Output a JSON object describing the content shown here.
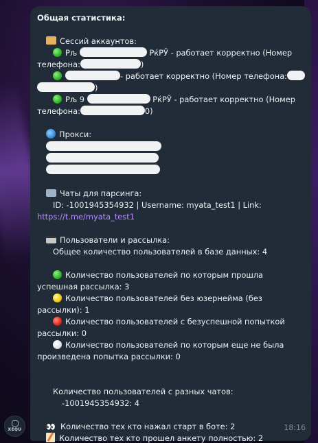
{
  "message": {
    "title": "Общая статистика:",
    "sessions": {
      "header": "Сессий аккаунтов:",
      "items": [
        {
          "prefix": "Рљ",
          "suffix": "РќРЎ - работает корректно (Номер",
          "line2_prefix": "телефона:",
          "line2_suffix": ")"
        },
        {
          "prefix": "",
          "suffix": "- работает корректно (Номер телефона:",
          "line2_prefix": "",
          "line2_suffix": ")"
        },
        {
          "prefix": "Рљ 9",
          "suffix": "РќРЎ - работает корректно (Номер",
          "line2_prefix": "телефона:",
          "line2_suffix": "0)"
        }
      ]
    },
    "proxy": {
      "header": "Прокси:"
    },
    "chats": {
      "header": "Чаты для парсинга:",
      "line": "ID: -1001945354932 | Username: myata_test1 | Link:",
      "link": "https://t.me/myata_test1"
    },
    "users": {
      "header": "Пользователи и рассылка:",
      "total": "Общее количество пользователей в базе данных: 4",
      "success_line1": "Количество пользователей по которым прошла",
      "success_line2": "успешная рассылка: 3",
      "no_username_line1": "Количество пользователей без юзернейма (без",
      "no_username_line2": "рассылки): 1",
      "failed_line1": "Количество пользователей с безуспешной попыткой",
      "failed_line2": "рассылки: 0",
      "not_tried_line1": "Количество пользователей по которым еще не была",
      "not_tried_line2": "произведена попытка рассылки: 0"
    },
    "by_chat": {
      "header": "Количество пользователей с разных чатов:",
      "entry": "-1001945354932: 4"
    },
    "start_count": "Количество тех кто нажал старт в боте: 2",
    "survey_count": "Количество тех кто прошел анкету полностью: 2",
    "time": "18:16"
  },
  "avatar": {
    "label": "XEQU"
  },
  "icons": {
    "sessions": "folder-icon",
    "proxy": "globe-icon",
    "chats": "mailbox-icon",
    "users": "card-icon",
    "start": "eyes-icon",
    "survey": "memo-icon"
  }
}
